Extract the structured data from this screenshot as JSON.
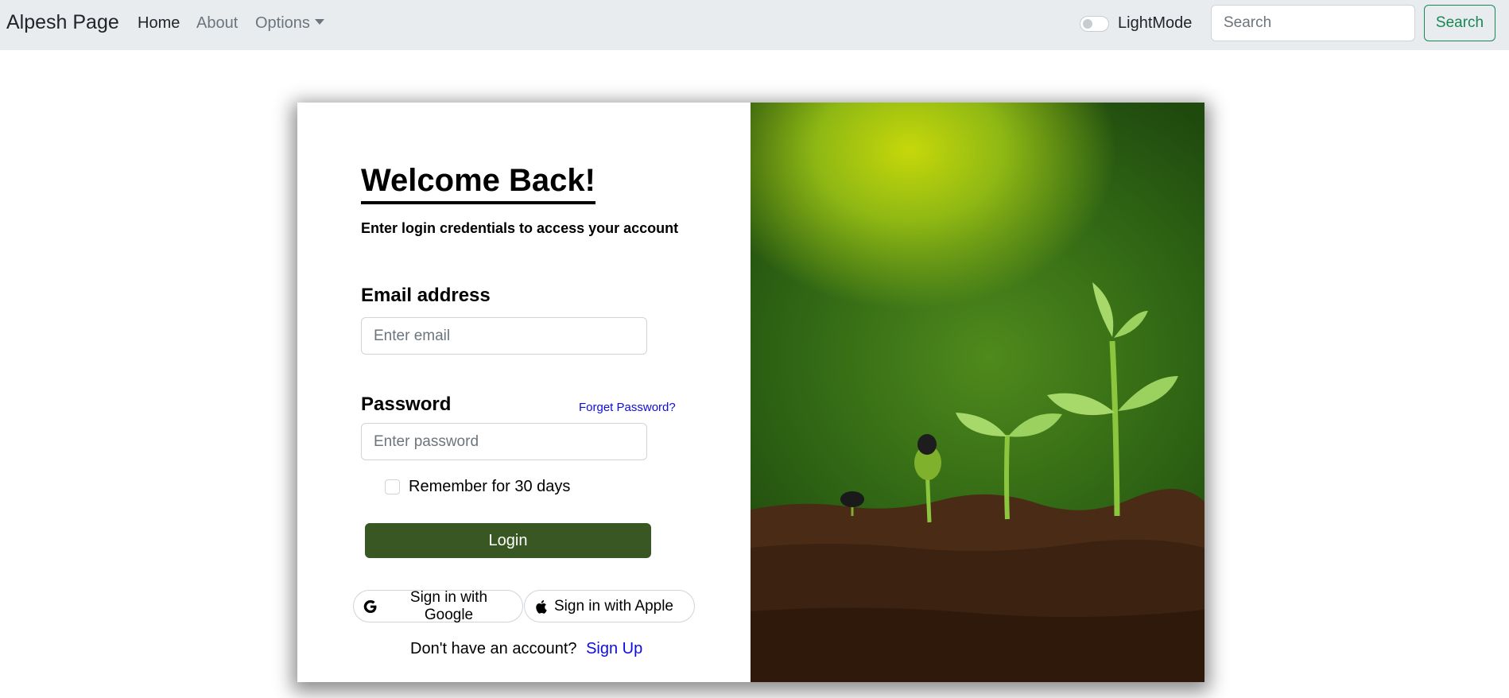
{
  "navbar": {
    "brand": "Alpesh Page",
    "links": {
      "home": "Home",
      "about": "About",
      "options": "Options"
    },
    "mode_label": "LightMode",
    "search_placeholder": "Search",
    "search_button": "Search"
  },
  "login": {
    "title": "Welcome Back!",
    "subtitle": "Enter login credentials to access your account",
    "email_label": "Email address",
    "email_placeholder": "Enter email",
    "password_label": "Password",
    "forgot_link": "Forget Password?",
    "password_placeholder": "Enter password",
    "remember_label": "Remember for 30 days",
    "login_button": "Login",
    "google_button": "Sign in with Google",
    "apple_button": "Sign in with Apple",
    "no_account_text": "Don't have an account?",
    "signup_link": "Sign Up"
  },
  "icons": {
    "google": "google-icon",
    "apple": "apple-icon",
    "toggle": "toggle-switch",
    "options_caret": "caret-down-icon"
  },
  "colors": {
    "navbar_bg": "#e9ecef",
    "search_accent": "#198754",
    "login_button": "#385723",
    "link": "#0d0de0"
  }
}
